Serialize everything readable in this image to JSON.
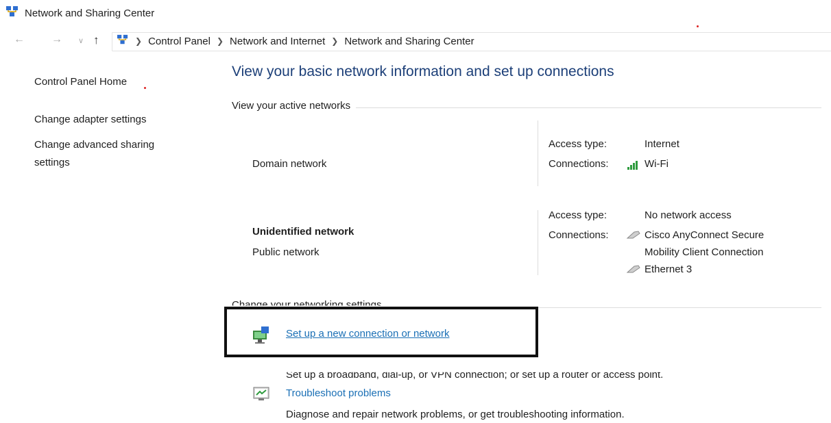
{
  "window": {
    "title": "Network and Sharing Center",
    "icon": "network-center-icon"
  },
  "address_bar": {
    "breadcrumbs": [
      "Control Panel",
      "Network and Internet",
      "Network and Sharing Center"
    ]
  },
  "left_pane": {
    "home": "Control Panel Home",
    "links": [
      "Change adapter settings",
      "Change advanced sharing settings"
    ]
  },
  "main": {
    "title": "View your basic network information and set up connections",
    "active_networks_header": "View your active networks",
    "networks": [
      {
        "name": "",
        "category": "Domain network",
        "access_label": "Access type:",
        "access_value": "Internet",
        "connections_label": "Connections:",
        "connections": [
          "Wi-Fi"
        ]
      },
      {
        "name": "Unidentified network",
        "category": "Public network",
        "access_label": "Access type:",
        "access_value": "No network access",
        "connections_label": "Connections:",
        "connections": [
          "Cisco AnyConnect Secure",
          "Mobility Client Connection",
          "Ethernet 3"
        ]
      }
    ],
    "change_settings_header": "Change your networking settings",
    "tasks": [
      {
        "label": "Set up a new connection or network",
        "description": "Set up a broadband, dial-up, or VPN connection; or set up a router or access point."
      },
      {
        "label": "Troubleshoot problems",
        "description": "Diagnose and repair network problems, or get troubleshooting information."
      }
    ]
  },
  "colors": {
    "link": "#1a6fb5",
    "title": "#1c3f78",
    "highlight_border": "#111111"
  }
}
